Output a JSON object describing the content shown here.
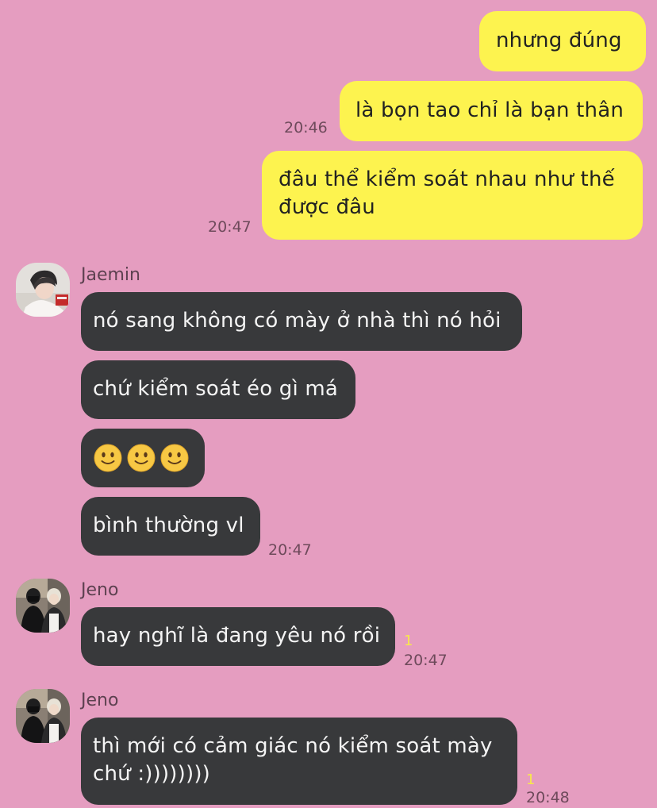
{
  "colors": {
    "background": "#e59dc0",
    "outgoing_bubble": "#fdf34f",
    "incoming_bubble": "#38393b",
    "unread_count": "#f8e84a"
  },
  "messages": {
    "out_1": {
      "text": "nhưng đúng"
    },
    "out_2": {
      "text": "là bọn tao chỉ là bạn thân",
      "time": "20:46"
    },
    "out_3": {
      "text": "đâu thể kiểm soát nhau như thế\nđược đâu",
      "time": "20:47"
    },
    "jaemin_group": {
      "sender": "Jaemin",
      "avatar_icon": "profile-photo",
      "msg_1": "nó sang không có mày ở nhà thì nó hỏi",
      "msg_2": "chứ kiểm soát éo gì má",
      "msg_3_emoji": "slightly-smiling-face x3",
      "msg_4": "bình thường vl",
      "time": "20:47"
    },
    "jeno_group_1": {
      "sender": "Jeno",
      "avatar_icon": "profile-photo",
      "msg_1": "hay nghĩ là đang yêu nó rồi",
      "unread": "1",
      "time": "20:47"
    },
    "jeno_group_2": {
      "sender": "Jeno",
      "avatar_icon": "profile-photo",
      "msg_1": "thì mới có cảm giác nó kiểm soát mày\nchứ :))))))))",
      "unread": "1",
      "time": "20:48"
    }
  }
}
